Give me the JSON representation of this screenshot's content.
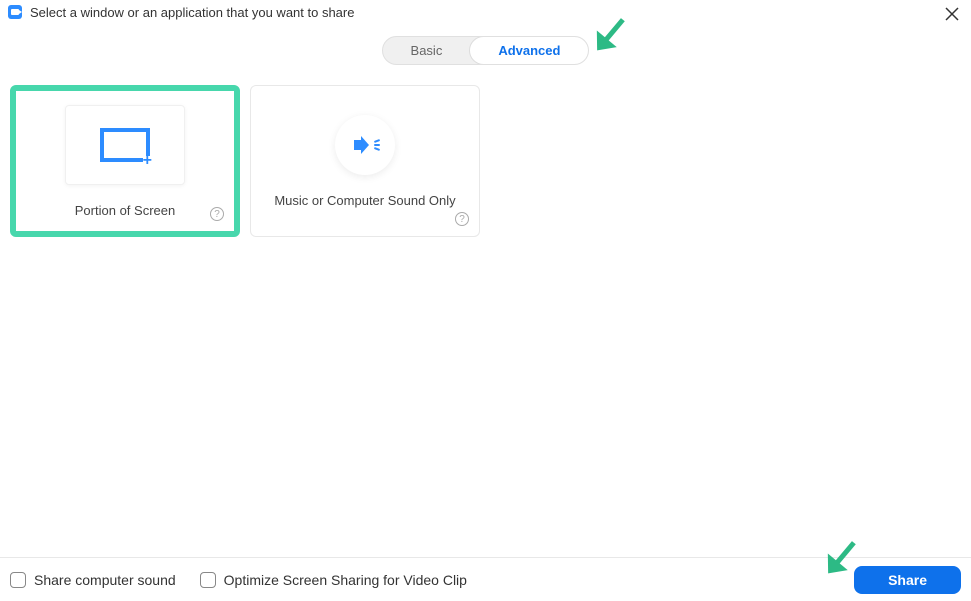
{
  "header": {
    "title": "Select a window or an application that you want to share"
  },
  "tabs": {
    "basic": "Basic",
    "advanced": "Advanced"
  },
  "options": {
    "portion": {
      "label": "Portion of Screen"
    },
    "sound": {
      "label": "Music or Computer Sound Only"
    }
  },
  "footer": {
    "shareSound": "Share computer sound",
    "optimizeVideo": "Optimize Screen Sharing for Video Clip",
    "shareButton": "Share"
  }
}
